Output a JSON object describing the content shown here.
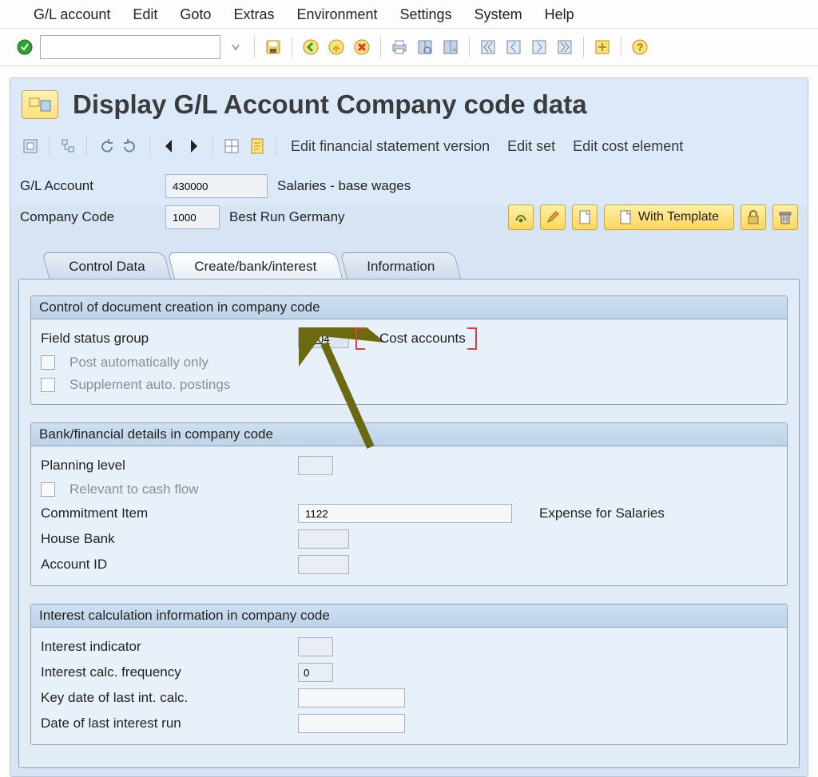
{
  "menu": {
    "items": [
      "G/L account",
      "Edit",
      "Goto",
      "Extras",
      "Environment",
      "Settings",
      "System",
      "Help"
    ]
  },
  "page": {
    "title": "Display G/L Account Company code data"
  },
  "subtoolbar": {
    "links": [
      "Edit financial statement version",
      "Edit set",
      "Edit cost element"
    ]
  },
  "header": {
    "account_label": "G/L Account",
    "account_value": "430000",
    "account_desc": "Salaries - base wages",
    "company_label": "Company Code",
    "company_value": "1000",
    "company_desc": "Best Run Germany",
    "with_template": "With Template"
  },
  "tabs": [
    "Control Data",
    "Create/bank/interest",
    "Information"
  ],
  "group1": {
    "title": "Control of document creation in company code",
    "field_status_label": "Field status group",
    "field_status_value": "G004",
    "field_status_desc": "Cost accounts",
    "post_auto": "Post automatically only",
    "supplement": "Supplement auto. postings"
  },
  "group2": {
    "title": "Bank/financial details in company code",
    "planning_label": "Planning level",
    "cashflow": "Relevant to cash flow",
    "commitment_label": "Commitment Item",
    "commitment_value": "1122",
    "commitment_desc": "Expense for Salaries",
    "housebank_label": "House Bank",
    "acctid_label": "Account ID"
  },
  "group3": {
    "title": "Interest calculation information in company code",
    "indicator": "Interest indicator",
    "freq": "Interest calc. frequency",
    "freq_value": "0",
    "keydate": "Key date of last int. calc.",
    "lastrun": "Date of last interest run"
  }
}
